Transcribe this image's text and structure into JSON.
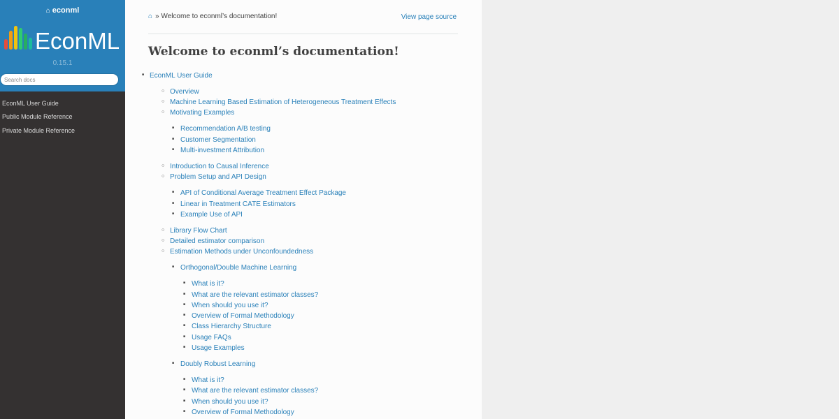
{
  "sidebar": {
    "project_name": "econml",
    "home_icon": "home-icon",
    "logo_text": "EconML",
    "logo_colors": [
      "#e74c3c",
      "#f39c12",
      "#f1c40f",
      "#2ecc71",
      "#27ae60",
      "#1abc9c"
    ],
    "version": "0.15.1",
    "search_placeholder": "Search docs",
    "nav_items": [
      "EconML User Guide",
      "Public Module Reference",
      "Private Module Reference"
    ]
  },
  "header": {
    "breadcrumb_home_icon": "home-icon",
    "breadcrumb_separator": "»",
    "breadcrumb_current": "Welcome to econml’s documentation!",
    "view_source": "View page source"
  },
  "main": {
    "title": "Welcome to econml’s documentation!",
    "toc": [
      {
        "label": "EconML User Guide",
        "level": 1
      },
      {
        "label": "Overview",
        "level": 2
      },
      {
        "label": "Machine Learning Based Estimation of Heterogeneous Treatment Effects",
        "level": 2
      },
      {
        "label": "Motivating Examples",
        "level": 2
      },
      {
        "label": "Recommendation A/B testing",
        "level": 3
      },
      {
        "label": "Customer Segmentation",
        "level": 3
      },
      {
        "label": "Multi-investment Attribution",
        "level": 3
      },
      {
        "label": "Introduction to Causal Inference",
        "level": 2
      },
      {
        "label": "Problem Setup and API Design",
        "level": 2
      },
      {
        "label": "API of Conditional Average Treatment Effect Package",
        "level": 3
      },
      {
        "label": "Linear in Treatment CATE Estimators",
        "level": 3
      },
      {
        "label": "Example Use of API",
        "level": 3
      },
      {
        "label": "Library Flow Chart",
        "level": 2
      },
      {
        "label": "Detailed estimator comparison",
        "level": 2
      },
      {
        "label": "Estimation Methods under Unconfoundedness",
        "level": 2
      },
      {
        "label": "Orthogonal/Double Machine Learning",
        "level": 3
      },
      {
        "label": "What is it?",
        "level": 4
      },
      {
        "label": "What are the relevant estimator classes?",
        "level": 4
      },
      {
        "label": "When should you use it?",
        "level": 4
      },
      {
        "label": "Overview of Formal Methodology",
        "level": 4
      },
      {
        "label": "Class Hierarchy Structure",
        "level": 4
      },
      {
        "label": "Usage FAQs",
        "level": 4
      },
      {
        "label": "Usage Examples",
        "level": 4
      },
      {
        "label": "Doubly Robust Learning",
        "level": 3
      },
      {
        "label": "What is it?",
        "level": 4
      },
      {
        "label": "What are the relevant estimator classes?",
        "level": 4
      },
      {
        "label": "When should you use it?",
        "level": 4
      },
      {
        "label": "Overview of Formal Methodology",
        "level": 4
      }
    ]
  }
}
